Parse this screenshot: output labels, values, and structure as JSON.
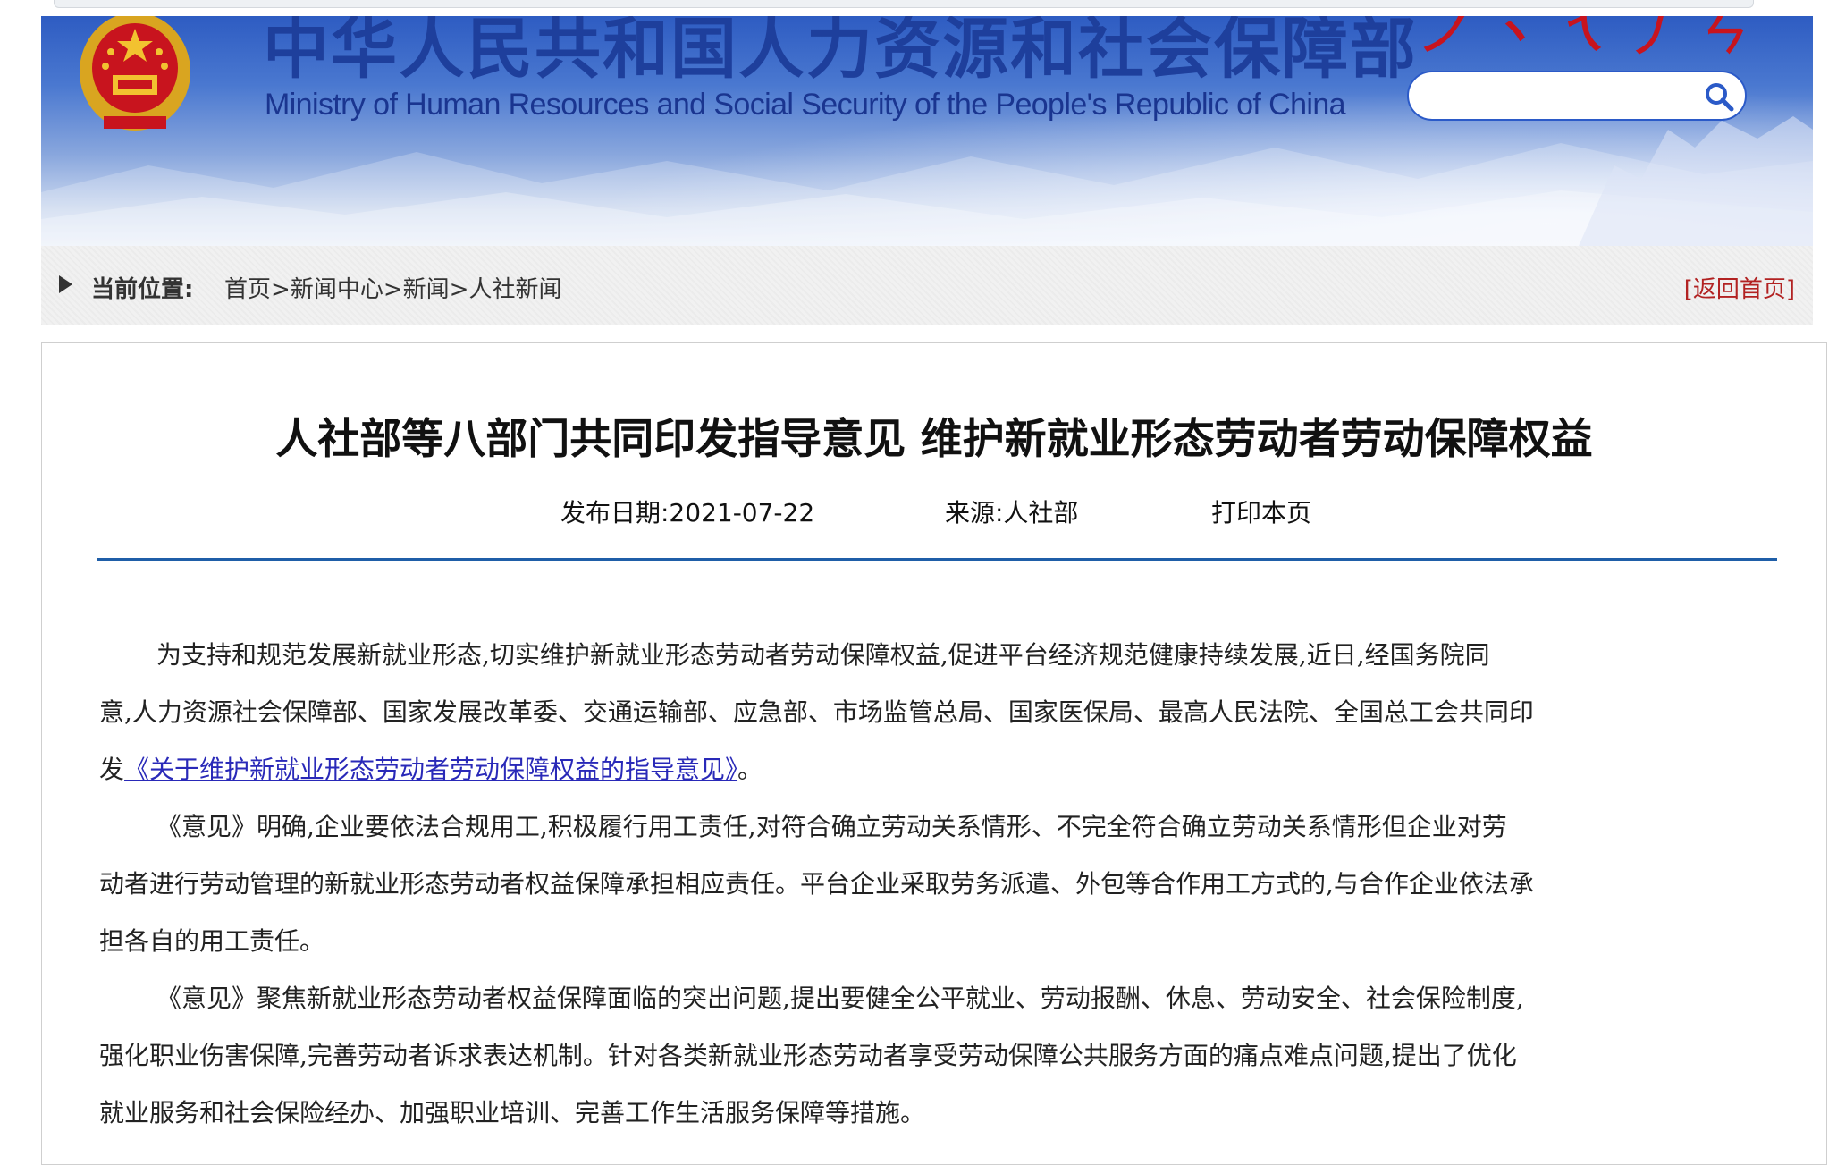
{
  "header": {
    "site_title": "中华人民共和国人力资源和社会保障部",
    "site_subtitle": "Ministry of Human Resources and Social Security of the People's Republic of China",
    "search_placeholder": "",
    "colors": {
      "banner_top": "#2e5cc2",
      "title": "#1e3f9c"
    }
  },
  "breadcrumb": {
    "label": "当前位置:",
    "items": [
      "首页",
      "新闻中心",
      "新闻",
      "人社新闻"
    ],
    "separator": ">",
    "back_home": "[返回首页]"
  },
  "article": {
    "title": "人社部等八部门共同印发指导意见 维护新就业形态劳动者劳动保障权益",
    "date": "发布日期:2021-07-22",
    "source": "来源:人社部",
    "print": "打印本页",
    "paragraphs": {
      "p1": {
        "line1": "为支持和规范发展新就业形态,切实维护新就业形态劳动者劳动保障权益,促进平台经济规范健康持续发展,近日,经国务院同",
        "line2": "意,人力资源社会保障部、国家发展改革委、交通运输部、应急部、市场监管总局、国家医保局、最高人民法院、全国总工会共同印",
        "line3_prefix": "发",
        "line3_link": "《关于维护新就业形态劳动者劳动保障权益的指导意见》",
        "line3_suffix": "。"
      },
      "p2": {
        "line1": "《意见》明确,企业要依法合规用工,积极履行用工责任,对符合确立劳动关系情形、不完全符合确立劳动关系情形但企业对劳",
        "line2": "动者进行劳动管理的新就业形态劳动者权益保障承担相应责任。平台企业采取劳务派遣、外包等合作用工方式的,与合作企业依法承",
        "line3": "担各自的用工责任。"
      },
      "p3": {
        "line1": "《意见》聚焦新就业形态劳动者权益保障面临的突出问题,提出要健全公平就业、劳动报酬、休息、劳动安全、社会保险制度,",
        "line2": "强化职业伤害保障,完善劳动者诉求表达机制。针对各类新就业形态劳动者享受劳动保障公共服务方面的痛点难点问题,提出了优化",
        "line3": "就业服务和社会保险经办、加强职业培训、完善工作生活服务保障等措施。"
      }
    },
    "colors": {
      "divider": "#1f5ea8",
      "link": "#2929b8",
      "back_home": "#b22222"
    }
  }
}
